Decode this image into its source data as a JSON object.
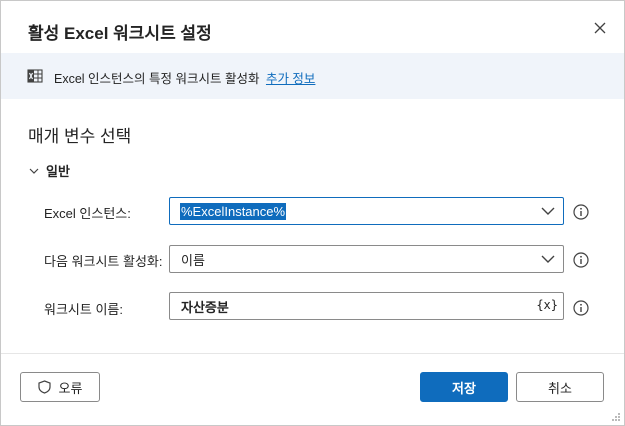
{
  "dialog": {
    "title": "활성 Excel 워크시트 설정",
    "close_icon": "close-icon"
  },
  "banner": {
    "icon": "excel-sheet-icon",
    "text": "Excel 인스턴스의 특정 워크시트 활성화",
    "link": "추가 정보"
  },
  "section": {
    "title": "매개 변수 선택"
  },
  "group": {
    "label": "일반",
    "icon": "chevron-down-icon"
  },
  "fields": {
    "instance": {
      "label": "Excel 인스턴스:",
      "value": "%ExcelInstance%"
    },
    "activate": {
      "label": "다음 워크시트 활성화:",
      "value": "이름"
    },
    "name": {
      "label": "워크시트 이름:",
      "value": "자산증분",
      "var_button": "{x}"
    }
  },
  "footer": {
    "error_label": "오류",
    "save_label": "저장",
    "cancel_label": "취소"
  },
  "colors": {
    "accent": "#0f6cbd",
    "banner_bg": "#f0f4fa"
  }
}
